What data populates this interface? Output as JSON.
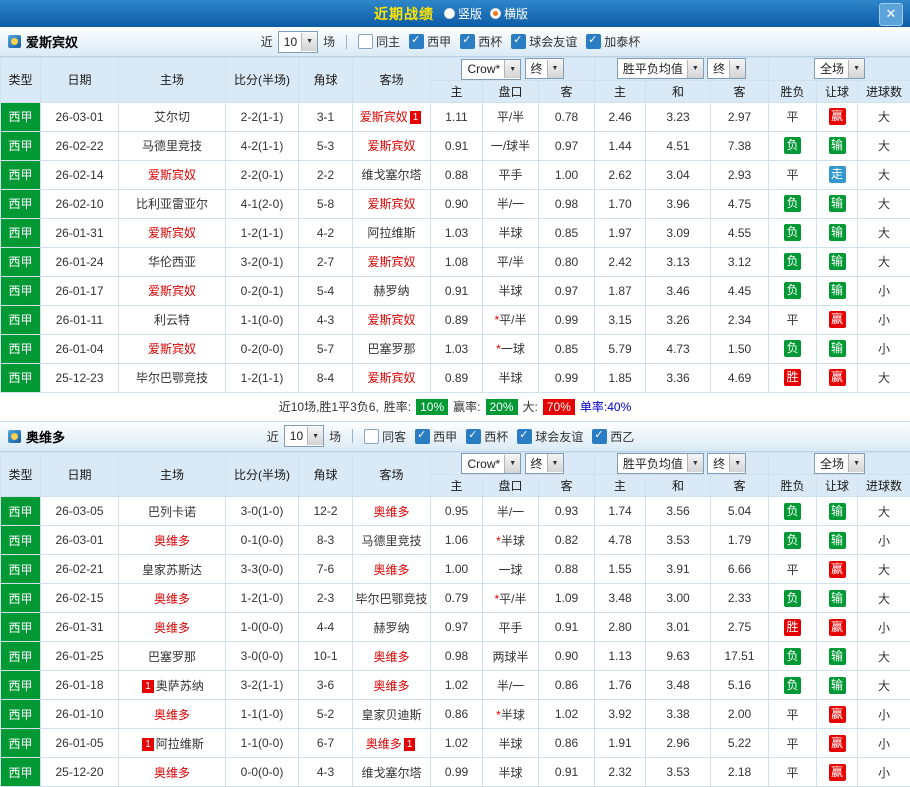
{
  "titlebar": {
    "title": "近期战绩",
    "radios": [
      {
        "label": "竖版",
        "checked": false
      },
      {
        "label": "横版",
        "checked": true
      }
    ],
    "close_label": "✕"
  },
  "table_header": {
    "col_type": "类型",
    "col_date": "日期",
    "col_home": "主场",
    "col_score": "比分(半场)",
    "col_corner": "角球",
    "col_away": "客场",
    "odds_company": "Crow*",
    "final_label": "终",
    "avg_label": "胜平负均值",
    "scope_label": "全场",
    "sub": [
      "主",
      "盘口",
      "客",
      "主",
      "和",
      "客",
      "胜负",
      "让球",
      "进球数"
    ]
  },
  "colors": {
    "green": "#009933",
    "red": "#e60000",
    "blue": "#3399cc"
  },
  "sections": [
    {
      "team": "爱斯宾奴",
      "near_label": "近",
      "near_value": "10",
      "near_suffix": "场",
      "filters": [
        {
          "label": "同主",
          "checked": false
        },
        {
          "label": "西甲",
          "checked": true
        },
        {
          "label": "西杯",
          "checked": true
        },
        {
          "label": "球会友谊",
          "checked": true
        },
        {
          "label": "加泰杯",
          "checked": true
        }
      ],
      "rows": [
        {
          "type": "西甲",
          "date": "26-03-01",
          "home": {
            "name": "艾尔切"
          },
          "score": "2-2(1-1)",
          "corner": "3-1",
          "away": {
            "name": "爱斯宾奴",
            "red": true,
            "badge_after": "1"
          },
          "odds": [
            "1.11",
            "平/半",
            "0.78"
          ],
          "avg": [
            "2.46",
            "3.23",
            "2.97"
          ],
          "result": "平",
          "handicap": "赢",
          "goals": "大"
        },
        {
          "type": "西甲",
          "date": "26-02-22",
          "home": {
            "name": "马德里竞技"
          },
          "score": "4-2(1-1)",
          "corner": "5-3",
          "away": {
            "name": "爱斯宾奴",
            "red": true
          },
          "odds": [
            "0.91",
            "一/球半",
            "0.97"
          ],
          "avg": [
            "1.44",
            "4.51",
            "7.38"
          ],
          "result": "负",
          "handicap": "输",
          "goals": "大"
        },
        {
          "type": "西甲",
          "date": "26-02-14",
          "home": {
            "name": "爱斯宾奴",
            "red": true
          },
          "score": "2-2(0-1)",
          "corner": "2-2",
          "away": {
            "name": "维戈塞尔塔"
          },
          "odds": [
            "0.88",
            "平手",
            "1.00"
          ],
          "avg": [
            "2.62",
            "3.04",
            "2.93"
          ],
          "result": "平",
          "handicap": "走",
          "goals": "大"
        },
        {
          "type": "西甲",
          "date": "26-02-10",
          "home": {
            "name": "比利亚雷亚尔"
          },
          "score": "4-1(2-0)",
          "corner": "5-8",
          "away": {
            "name": "爱斯宾奴",
            "red": true
          },
          "odds": [
            "0.90",
            "半/一",
            "0.98"
          ],
          "avg": [
            "1.70",
            "3.96",
            "4.75"
          ],
          "result": "负",
          "handicap": "输",
          "goals": "大"
        },
        {
          "type": "西甲",
          "date": "26-01-31",
          "home": {
            "name": "爱斯宾奴",
            "red": true
          },
          "score": "1-2(1-1)",
          "corner": "4-2",
          "away": {
            "name": "阿拉维斯"
          },
          "odds": [
            "1.03",
            "半球",
            "0.85"
          ],
          "avg": [
            "1.97",
            "3.09",
            "4.55"
          ],
          "result": "负",
          "handicap": "输",
          "goals": "大"
        },
        {
          "type": "西甲",
          "date": "26-01-24",
          "home": {
            "name": "华伦西亚"
          },
          "score": "3-2(0-1)",
          "corner": "2-7",
          "away": {
            "name": "爱斯宾奴",
            "red": true
          },
          "odds": [
            "1.08",
            "平/半",
            "0.80"
          ],
          "avg": [
            "2.42",
            "3.13",
            "3.12"
          ],
          "result": "负",
          "handicap": "输",
          "goals": "大"
        },
        {
          "type": "西甲",
          "date": "26-01-17",
          "home": {
            "name": "爱斯宾奴",
            "red": true
          },
          "score": "0-2(0-1)",
          "corner": "5-4",
          "away": {
            "name": "赫罗纳"
          },
          "odds": [
            "0.91",
            "半球",
            "0.97"
          ],
          "avg": [
            "1.87",
            "3.46",
            "4.45"
          ],
          "result": "负",
          "handicap": "输",
          "goals": "小"
        },
        {
          "type": "西甲",
          "date": "26-01-11",
          "home": {
            "name": "利云特"
          },
          "score": "1-1(0-0)",
          "corner": "4-3",
          "away": {
            "name": "爱斯宾奴",
            "red": true
          },
          "odds": [
            "0.89",
            "*平/半",
            "0.99"
          ],
          "avg": [
            "3.15",
            "3.26",
            "2.34"
          ],
          "result": "平",
          "handicap": "赢",
          "goals": "小"
        },
        {
          "type": "西甲",
          "date": "26-01-04",
          "home": {
            "name": "爱斯宾奴",
            "red": true
          },
          "score": "0-2(0-0)",
          "corner": "5-7",
          "away": {
            "name": "巴塞罗那"
          },
          "odds": [
            "1.03",
            "*一球",
            "0.85"
          ],
          "avg": [
            "5.79",
            "4.73",
            "1.50"
          ],
          "result": "负",
          "handicap": "输",
          "goals": "小"
        },
        {
          "type": "西甲",
          "date": "25-12-23",
          "home": {
            "name": "毕尔巴鄂竞技"
          },
          "score": "1-2(1-1)",
          "corner": "8-4",
          "away": {
            "name": "爱斯宾奴",
            "red": true
          },
          "odds": [
            "0.89",
            "半球",
            "0.99"
          ],
          "avg": [
            "1.85",
            "3.36",
            "4.69"
          ],
          "result": "胜",
          "handicap": "赢",
          "goals": "大"
        }
      ],
      "summary": {
        "prefix": "近10场,胜1平3负6,",
        "win_rate_label": "胜率:",
        "win_rate": "10%",
        "profit_rate_label": "赢率:",
        "profit_rate": "20%",
        "big_label": "大:",
        "big_rate": "70%",
        "single_label": "单率:40%"
      }
    },
    {
      "team": "奥维多",
      "near_label": "近",
      "near_value": "10",
      "near_suffix": "场",
      "filters": [
        {
          "label": "同客",
          "checked": false
        },
        {
          "label": "西甲",
          "checked": true
        },
        {
          "label": "西杯",
          "checked": true
        },
        {
          "label": "球会友谊",
          "checked": true
        },
        {
          "label": "西乙",
          "checked": true
        }
      ],
      "rows": [
        {
          "type": "西甲",
          "date": "26-03-05",
          "home": {
            "name": "巴列卡诺"
          },
          "score": "3-0(1-0)",
          "corner": "12-2",
          "away": {
            "name": "奥维多",
            "red": true
          },
          "odds": [
            "0.95",
            "半/一",
            "0.93"
          ],
          "avg": [
            "1.74",
            "3.56",
            "5.04"
          ],
          "result": "负",
          "handicap": "输",
          "goals": "大"
        },
        {
          "type": "西甲",
          "date": "26-03-01",
          "home": {
            "name": "奥维多",
            "red": true
          },
          "score": "0-1(0-0)",
          "corner": "8-3",
          "away": {
            "name": "马德里竞技"
          },
          "odds": [
            "1.06",
            "*半球",
            "0.82"
          ],
          "avg": [
            "4.78",
            "3.53",
            "1.79"
          ],
          "result": "负",
          "handicap": "输",
          "goals": "小"
        },
        {
          "type": "西甲",
          "date": "26-02-21",
          "home": {
            "name": "皇家苏斯达"
          },
          "score": "3-3(0-0)",
          "corner": "7-6",
          "away": {
            "name": "奥维多",
            "red": true
          },
          "odds": [
            "1.00",
            "一球",
            "0.88"
          ],
          "avg": [
            "1.55",
            "3.91",
            "6.66"
          ],
          "result": "平",
          "handicap": "赢",
          "goals": "大"
        },
        {
          "type": "西甲",
          "date": "26-02-15",
          "home": {
            "name": "奥维多",
            "red": true
          },
          "score": "1-2(1-0)",
          "corner": "2-3",
          "away": {
            "name": "毕尔巴鄂竞技"
          },
          "odds": [
            "0.79",
            "*平/半",
            "1.09"
          ],
          "avg": [
            "3.48",
            "3.00",
            "2.33"
          ],
          "result": "负",
          "handicap": "输",
          "goals": "大"
        },
        {
          "type": "西甲",
          "date": "26-01-31",
          "home": {
            "name": "奥维多",
            "red": true
          },
          "score": "1-0(0-0)",
          "corner": "4-4",
          "away": {
            "name": "赫罗纳"
          },
          "odds": [
            "0.97",
            "平手",
            "0.91"
          ],
          "avg": [
            "2.80",
            "3.01",
            "2.75"
          ],
          "result": "胜",
          "handicap": "赢",
          "goals": "小"
        },
        {
          "type": "西甲",
          "date": "26-01-25",
          "home": {
            "name": "巴塞罗那"
          },
          "score": "3-0(0-0)",
          "corner": "10-1",
          "away": {
            "name": "奥维多",
            "red": true
          },
          "odds": [
            "0.98",
            "两球半",
            "0.90"
          ],
          "avg": [
            "1.13",
            "9.63",
            "17.51"
          ],
          "result": "负",
          "handicap": "输",
          "goals": "大"
        },
        {
          "type": "西甲",
          "date": "26-01-18",
          "home": {
            "name": "奥萨苏纳",
            "badge_before": "1"
          },
          "score": "3-2(1-1)",
          "corner": "3-6",
          "away": {
            "name": "奥维多",
            "red": true
          },
          "odds": [
            "1.02",
            "半/一",
            "0.86"
          ],
          "avg": [
            "1.76",
            "3.48",
            "5.16"
          ],
          "result": "负",
          "handicap": "输",
          "goals": "大"
        },
        {
          "type": "西甲",
          "date": "26-01-10",
          "home": {
            "name": "奥维多",
            "red": true
          },
          "score": "1-1(1-0)",
          "corner": "5-2",
          "away": {
            "name": "皇家贝迪斯"
          },
          "odds": [
            "0.86",
            "*半球",
            "1.02"
          ],
          "avg": [
            "3.92",
            "3.38",
            "2.00"
          ],
          "result": "平",
          "handicap": "赢",
          "goals": "小"
        },
        {
          "type": "西甲",
          "date": "26-01-05",
          "home": {
            "name": "阿拉维斯",
            "badge_before": "1"
          },
          "score": "1-1(0-0)",
          "corner": "6-7",
          "away": {
            "name": "奥维多",
            "red": true,
            "badge_after": "1"
          },
          "odds": [
            "1.02",
            "半球",
            "0.86"
          ],
          "avg": [
            "1.91",
            "2.96",
            "5.22"
          ],
          "result": "平",
          "handicap": "赢",
          "goals": "小"
        },
        {
          "type": "西甲",
          "date": "25-12-20",
          "home": {
            "name": "奥维多",
            "red": true
          },
          "score": "0-0(0-0)",
          "corner": "4-3",
          "away": {
            "name": "维戈塞尔塔"
          },
          "odds": [
            "0.99",
            "半球",
            "0.91"
          ],
          "avg": [
            "2.32",
            "3.53",
            "2.18"
          ],
          "result": "平",
          "handicap": "赢",
          "goals": "小"
        }
      ]
    }
  ]
}
